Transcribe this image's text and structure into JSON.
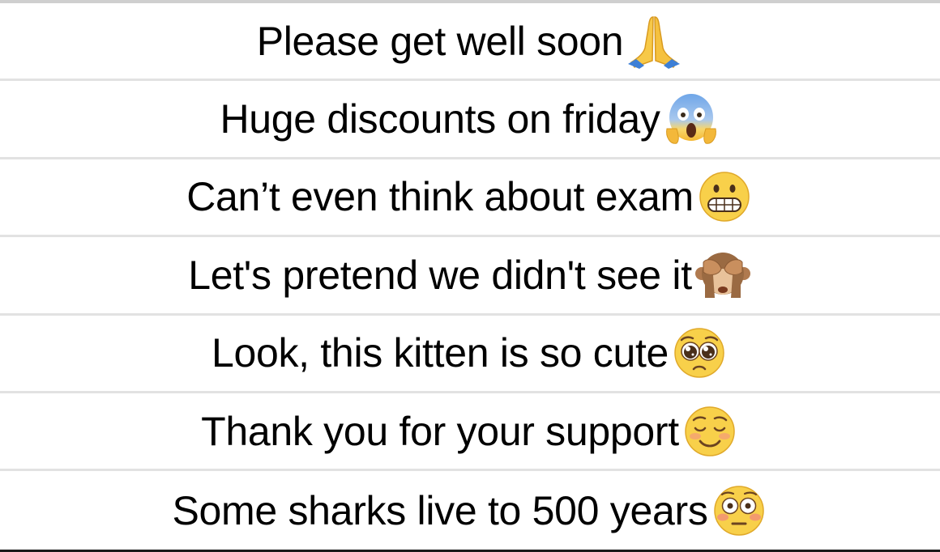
{
  "rows": [
    {
      "text": "Please get well soon",
      "emoji": "folded-hands-emoji"
    },
    {
      "text": "Huge discounts on friday",
      "emoji": "face-screaming-in-fear-emoji"
    },
    {
      "text": "Can’t even think about exam",
      "emoji": "grimacing-face-emoji"
    },
    {
      "text": "Let's pretend we didn't see it",
      "emoji": "see-no-evil-monkey-emoji"
    },
    {
      "text": "Look, this kitten is so cute",
      "emoji": "pleading-face-emoji"
    },
    {
      "text": "Thank you for your support",
      "emoji": "smiling-face-emoji"
    },
    {
      "text": "Some sharks live to 500 years",
      "emoji": "flushed-face-emoji"
    }
  ]
}
